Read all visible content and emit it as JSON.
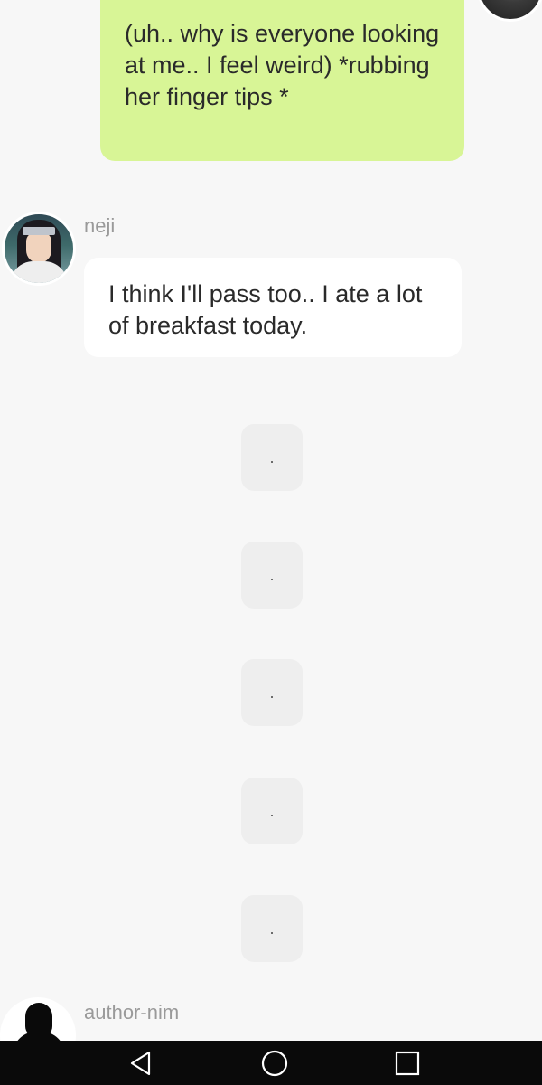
{
  "messages": {
    "outgoing": {
      "text": "(uh..  why is everyone looking at me..  I feel weird) *rubbing her finger tips *"
    },
    "neji": {
      "sender": "neji",
      "text": "I think I'll pass too..  I ate a lot of breakfast today."
    },
    "placeholders": [
      ".",
      ".",
      ".",
      ".",
      "."
    ],
    "author": {
      "sender": "author-nim"
    }
  },
  "icons": {
    "self_avatar": "avatar-icon",
    "neji_avatar": "avatar-icon",
    "author_avatar": "silhouette-avatar-icon",
    "nav_back": "triangle-back-icon",
    "nav_home": "circle-home-icon",
    "nav_recents": "square-recents-icon"
  },
  "colors": {
    "background": "#f7f7f7",
    "outgoing_bubble": "#d8f596",
    "incoming_bubble": "#ffffff",
    "placeholder_bubble": "#eeeeee",
    "navbar": "#0a0a0a",
    "sender_name": "#9a9a9a"
  }
}
